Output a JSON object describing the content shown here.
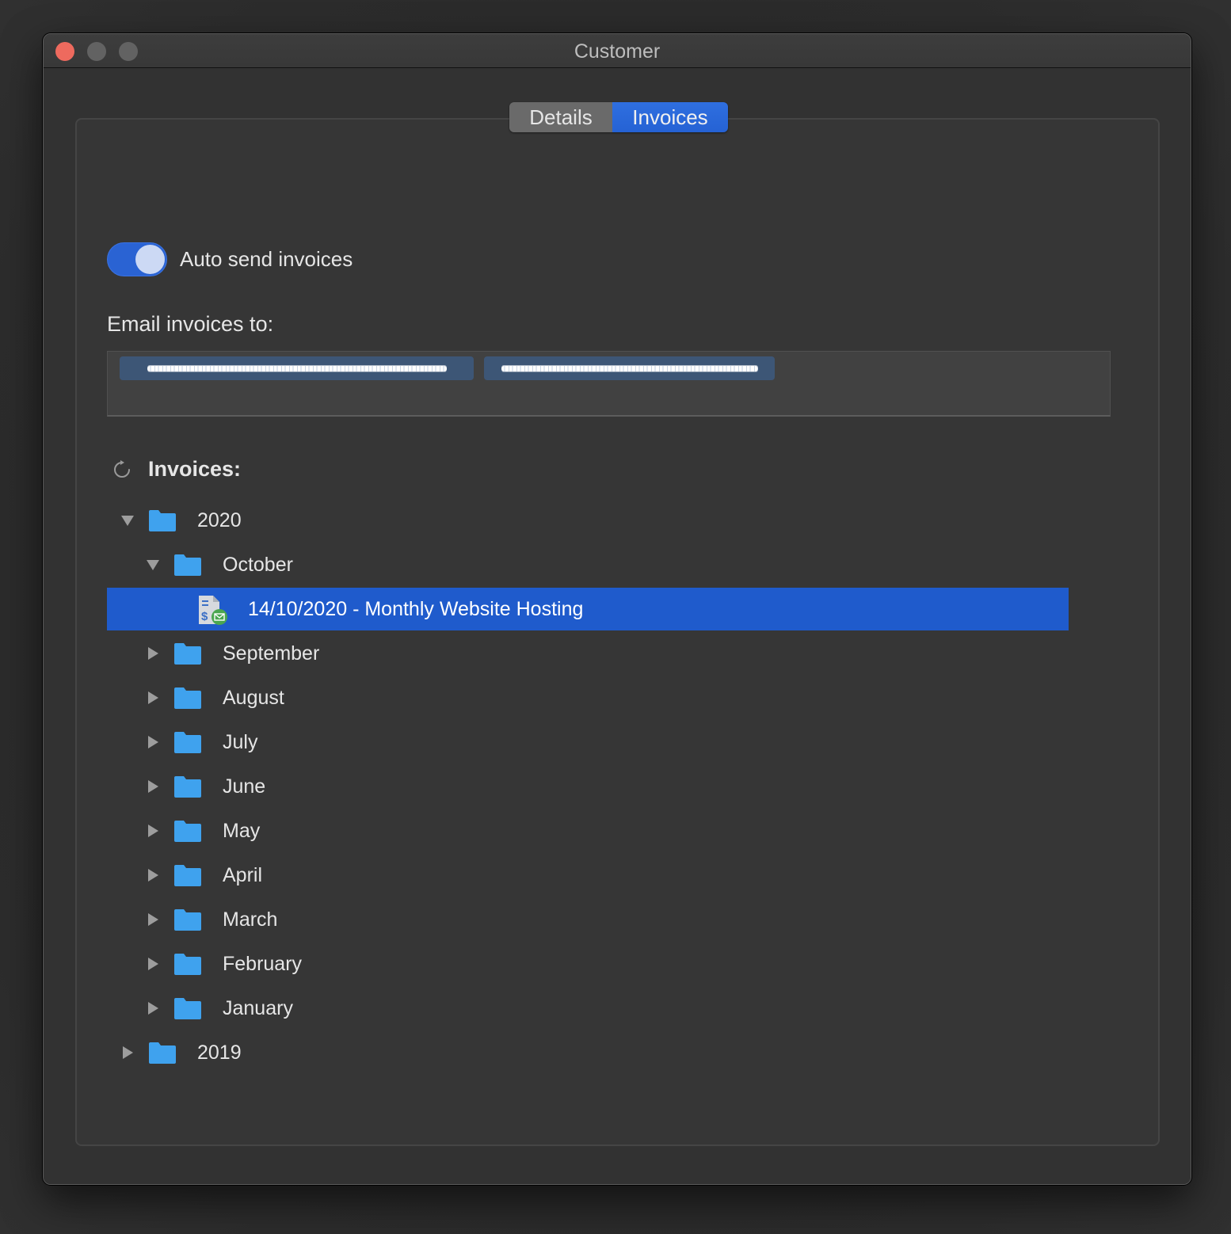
{
  "window": {
    "title": "Customer",
    "controls": [
      "close",
      "minimize",
      "maximize"
    ]
  },
  "tabs": [
    {
      "label": "Details",
      "selected": false
    },
    {
      "label": "Invoices",
      "selected": true
    }
  ],
  "auto_send": {
    "label": "Auto send invoices",
    "enabled": true
  },
  "email": {
    "label": "Email invoices to:",
    "tokens": [
      {
        "value": "[redacted email]",
        "redacted": true
      },
      {
        "value": "[redacted email]",
        "redacted": true
      }
    ]
  },
  "invoices": {
    "title": "Invoices:",
    "refresh_icon": "refresh-icon",
    "tree": [
      {
        "label": "2020",
        "type": "folder",
        "level": 0,
        "expanded": true
      },
      {
        "label": "October",
        "type": "folder",
        "level": 1,
        "expanded": true
      },
      {
        "label": "14/10/2020 - Monthly Website Hosting",
        "type": "invoice",
        "level": 2,
        "selected": true,
        "icon": "invoice-emailed-icon"
      },
      {
        "label": "September",
        "type": "folder",
        "level": 1,
        "expanded": false
      },
      {
        "label": "August",
        "type": "folder",
        "level": 1,
        "expanded": false
      },
      {
        "label": "July",
        "type": "folder",
        "level": 1,
        "expanded": false
      },
      {
        "label": "June",
        "type": "folder",
        "level": 1,
        "expanded": false
      },
      {
        "label": "May",
        "type": "folder",
        "level": 1,
        "expanded": false
      },
      {
        "label": "April",
        "type": "folder",
        "level": 1,
        "expanded": false
      },
      {
        "label": "March",
        "type": "folder",
        "level": 1,
        "expanded": false
      },
      {
        "label": "February",
        "type": "folder",
        "level": 1,
        "expanded": false
      },
      {
        "label": "January",
        "type": "folder",
        "level": 1,
        "expanded": false
      },
      {
        "label": "2019",
        "type": "folder",
        "level": 0,
        "expanded": false
      }
    ]
  },
  "colors": {
    "accent": "#1f5bcc",
    "folder": "#3fa2ee",
    "close_button": "#ee6a5e"
  }
}
